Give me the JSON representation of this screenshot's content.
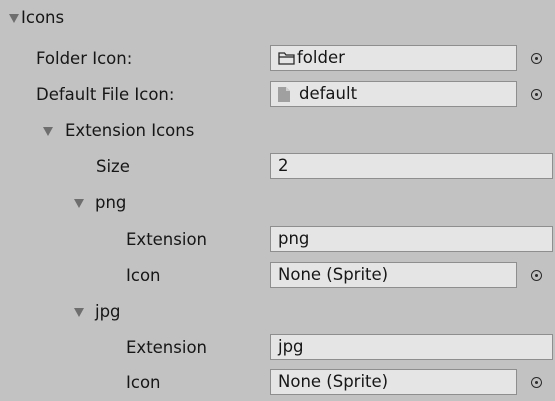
{
  "icons_section": {
    "label": "Icons",
    "folder_icon": {
      "label": "Folder Icon:",
      "value": "folder",
      "icon": "folder-icon"
    },
    "default_file_icon": {
      "label": "Default File Icon:",
      "value": "default",
      "icon": "file-icon"
    },
    "extension_icons": {
      "label": "Extension Icons",
      "size_label": "Size",
      "size_value": "2",
      "items": [
        {
          "label": "png",
          "extension_label": "Extension",
          "extension_value": "png",
          "icon_label": "Icon",
          "icon_value": "None (Sprite)"
        },
        {
          "label": "jpg",
          "extension_label": "Extension",
          "extension_value": "jpg",
          "icon_label": "Icon",
          "icon_value": "None (Sprite)"
        }
      ]
    }
  }
}
